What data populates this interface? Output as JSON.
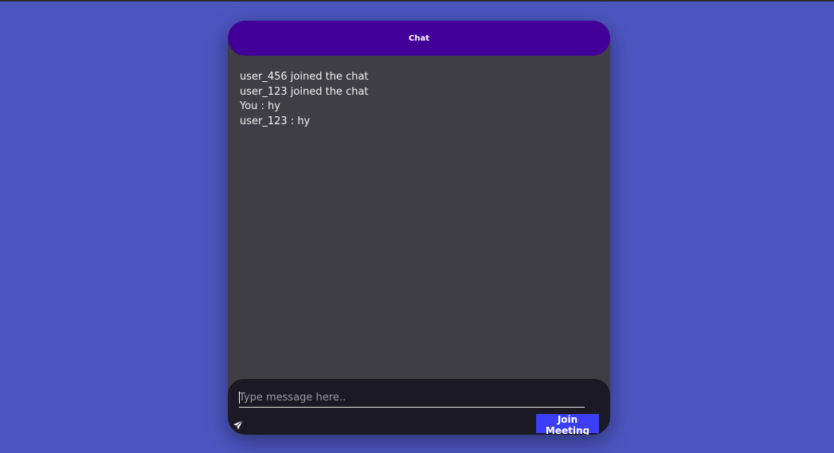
{
  "chat": {
    "title": "Chat",
    "messages": [
      "user_456 joined the chat",
      "user_123 joined the chat",
      "You : hy",
      "user_123 : hy"
    ]
  },
  "composer": {
    "placeholder": "Type message here..",
    "value": "",
    "send_icon": "paper-plane-icon",
    "join_label": "Join Meeting"
  },
  "colors": {
    "page_background": "#4b55bf",
    "header_background": "#430099",
    "chat_background": "#3f3e44",
    "composer_background": "#1b1a24",
    "join_button": "#3b3ef5"
  }
}
